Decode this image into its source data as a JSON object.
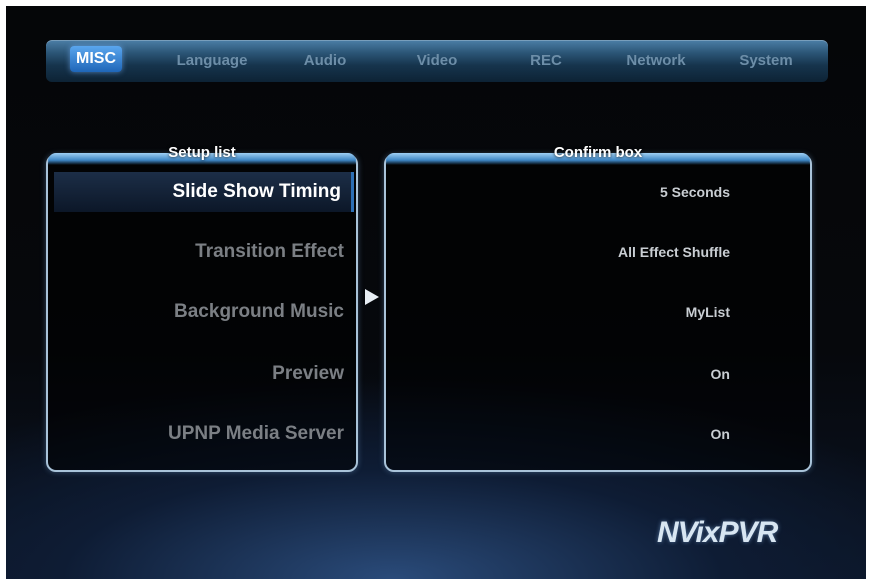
{
  "menu": {
    "tabs": [
      {
        "label": "MISC",
        "active": true
      },
      {
        "label": "Language"
      },
      {
        "label": "Audio"
      },
      {
        "label": "Video"
      },
      {
        "label": "REC"
      },
      {
        "label": "Network"
      },
      {
        "label": "System"
      }
    ]
  },
  "setup_list": {
    "title": "Setup list",
    "items": [
      {
        "label": "Slide Show Timing",
        "selected": true
      },
      {
        "label": "Transition Effect"
      },
      {
        "label": "Background Music"
      },
      {
        "label": "Preview"
      },
      {
        "label": "UPNP Media Server"
      }
    ]
  },
  "confirm_box": {
    "title": "Confirm box",
    "values": [
      "5 Seconds",
      "All Effect Shuffle",
      "MyList",
      "On",
      "On"
    ]
  },
  "logo": {
    "text": "NVixPVR"
  },
  "colors": {
    "accent": "#2c6fb5",
    "panel_border": "#a9c3d9",
    "active_tab": "#3c8bdb"
  }
}
